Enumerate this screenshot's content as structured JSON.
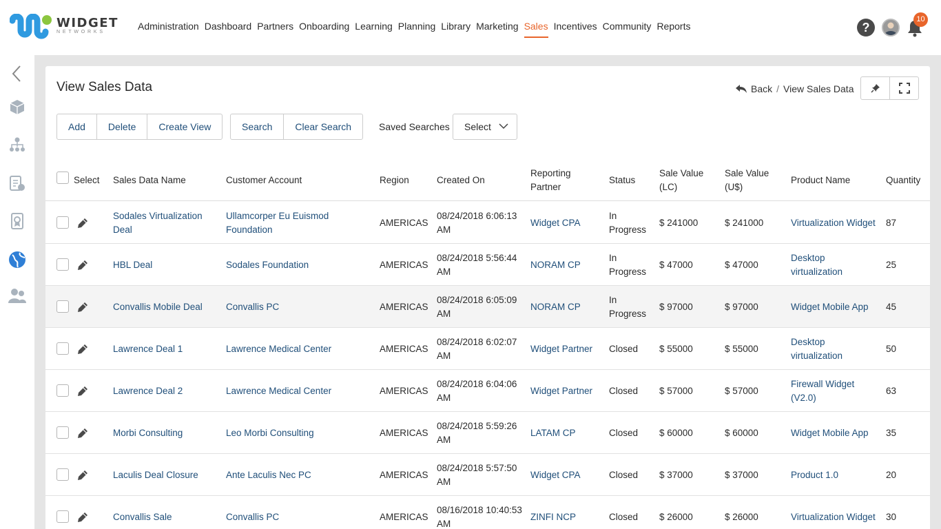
{
  "brand": {
    "name": "WIDGET",
    "sub": "NETWORKS"
  },
  "nav": {
    "items": [
      {
        "label": "Administration",
        "active": false
      },
      {
        "label": "Dashboard",
        "active": false
      },
      {
        "label": "Partners",
        "active": false
      },
      {
        "label": "Onboarding",
        "active": false
      },
      {
        "label": "Learning",
        "active": false
      },
      {
        "label": "Planning",
        "active": false
      },
      {
        "label": "Library",
        "active": false
      },
      {
        "label": "Marketing",
        "active": false
      },
      {
        "label": "Sales",
        "active": true
      },
      {
        "label": "Incentives",
        "active": false
      },
      {
        "label": "Community",
        "active": false
      },
      {
        "label": "Reports",
        "active": false
      }
    ],
    "help": "?",
    "notification_count": "10"
  },
  "colors": {
    "accent": "#e8652b",
    "link": "#1f4e79",
    "brand_blue": "#2f9ae0",
    "brand_green": "#8cc63f"
  },
  "page": {
    "title": "View Sales Data",
    "breadcrumb": {
      "back": "Back",
      "sep": "/",
      "current": "View Sales Data"
    }
  },
  "toolbar": {
    "add": "Add",
    "delete": "Delete",
    "create_view": "Create View",
    "search": "Search",
    "clear_search": "Clear Search",
    "saved_searches": "Saved Searches",
    "select": "Select"
  },
  "table": {
    "headers": {
      "select": "Select",
      "name": "Sales Data Name",
      "customer": "Customer Account",
      "region": "Region",
      "created": "Created On",
      "partner": "Reporting Partner",
      "status": "Status",
      "lc": "Sale Value (LC)",
      "us": "Sale Value (U$)",
      "product": "Product Name",
      "qty": "Quantity"
    },
    "rows": [
      {
        "name": "Sodales Virtualization Deal",
        "customer": "Ullamcorper Eu Euismod Foundation",
        "region": "AMERICAS",
        "created": "08/24/2018 6:06:13 AM",
        "partner": "Widget CPA",
        "status": "In Progress",
        "lc": "$ 241000",
        "us": "$ 241000",
        "product": "Virtualization Widget",
        "qty": "87"
      },
      {
        "name": "HBL Deal",
        "customer": "Sodales Foundation",
        "region": "AMERICAS",
        "created": "08/24/2018 5:56:44 AM",
        "partner": "NORAM CP",
        "status": "In Progress",
        "lc": "$ 47000",
        "us": "$ 47000",
        "product": "Desktop virtualization",
        "qty": "25"
      },
      {
        "name": "Convallis Mobile Deal",
        "customer": "Convallis PC",
        "region": "AMERICAS",
        "created": "08/24/2018 6:05:09 AM",
        "partner": "NORAM CP",
        "status": "In Progress",
        "lc": "$ 97000",
        "us": "$ 97000",
        "product": "Widget Mobile App",
        "qty": "45"
      },
      {
        "name": "Lawrence Deal 1",
        "customer": "Lawrence Medical Center",
        "region": "AMERICAS",
        "created": "08/24/2018 6:02:07 AM",
        "partner": "Widget Partner",
        "status": "Closed",
        "lc": "$ 55000",
        "us": "$ 55000",
        "product": "Desktop virtualization",
        "qty": "50"
      },
      {
        "name": "Lawrence Deal 2",
        "customer": "Lawrence Medical Center",
        "region": "AMERICAS",
        "created": "08/24/2018 6:04:06 AM",
        "partner": "Widget Partner",
        "status": "Closed",
        "lc": "$ 57000",
        "us": "$ 57000",
        "product": "Firewall Widget (V2.0)",
        "qty": "63"
      },
      {
        "name": "Morbi Consulting",
        "customer": "Leo Morbi Consulting",
        "region": "AMERICAS",
        "created": "08/24/2018 5:59:26 AM",
        "partner": "LATAM CP",
        "status": "Closed",
        "lc": "$ 60000",
        "us": "$ 60000",
        "product": "Widget Mobile App",
        "qty": "35"
      },
      {
        "name": "Laculis Deal Closure",
        "customer": "Ante Laculis Nec PC",
        "region": "AMERICAS",
        "created": "08/24/2018 5:57:50 AM",
        "partner": "Widget CPA",
        "status": "Closed",
        "lc": "$ 37000",
        "us": "$ 37000",
        "product": "Product 1.0",
        "qty": "20"
      },
      {
        "name": "Convallis Sale",
        "customer": "Convallis PC",
        "region": "AMERICAS",
        "created": "08/16/2018 10:40:53 AM",
        "partner": "ZINFI NCP",
        "status": "Closed",
        "lc": "$ 26000",
        "us": "$ 26000",
        "product": "Virtualization Widget",
        "qty": "30"
      }
    ]
  },
  "sidebar": {
    "icons": [
      "collapse-arrow-icon",
      "box-icon",
      "org-chart-icon",
      "document-dollar-icon",
      "certificate-icon",
      "globe-icon",
      "users-icon"
    ]
  }
}
